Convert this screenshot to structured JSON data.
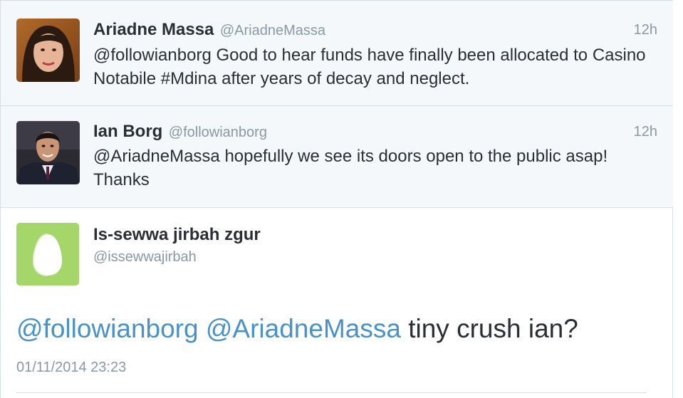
{
  "thread": [
    {
      "name": "Ariadne Massa",
      "handle": "@AriadneMassa",
      "time": "12h",
      "text": "@followianborg Good to hear funds have finally been allocated to Casino Notabile #Mdina after years of decay and neglect.",
      "avatar": "profile-photo-woman"
    },
    {
      "name": "Ian Borg",
      "handle": "@followianborg",
      "time": "12h",
      "text": "@AriadneMassa hopefully we see its doors open to the public asap! Thanks",
      "avatar": "profile-photo-man"
    }
  ],
  "main_tweet": {
    "name": "Is-sewwa jirbah zgur",
    "handle": "@issewwajirbah",
    "mention1": "@followianborg",
    "mention2": "@AriadneMassa",
    "text": " tiny crush ian?",
    "date": "01/11/2014 23:23",
    "avatar": "default-egg-avatar",
    "avatar_color": "#a5d66a"
  },
  "colors": {
    "mention": "#4a90c9",
    "muted": "#8899a6",
    "text": "#292f33",
    "reply_bg": "#f5f8fa"
  }
}
